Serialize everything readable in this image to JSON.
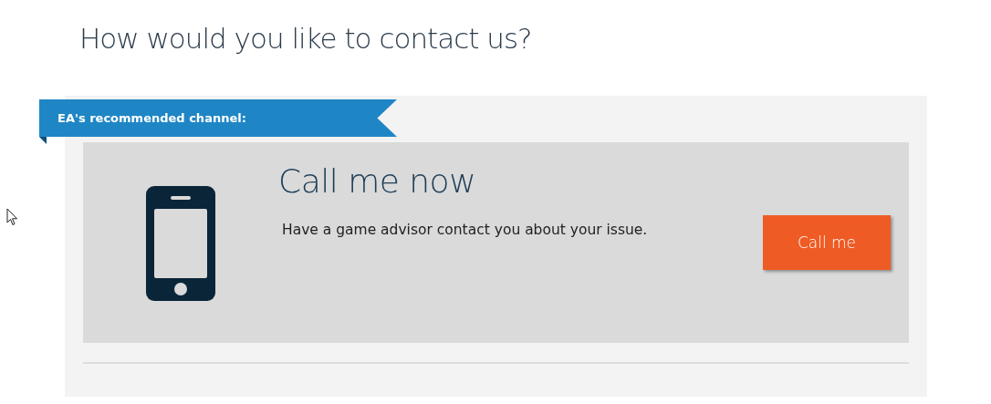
{
  "heading": "How would you like to contact us?",
  "ribbon": {
    "label": "EA's recommended channel:"
  },
  "channel": {
    "title": "Call me now",
    "description": "Have a game advisor contact you about your issue.",
    "button": "Call me"
  }
}
